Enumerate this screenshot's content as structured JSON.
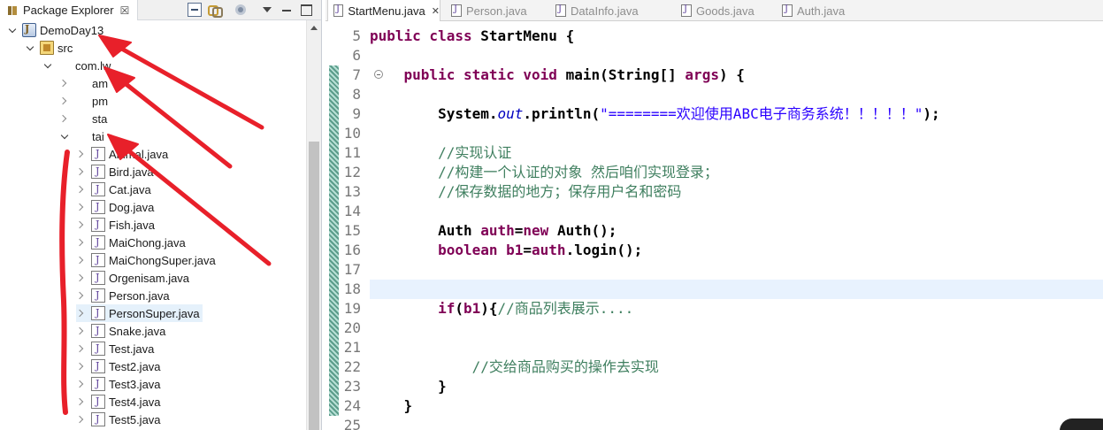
{
  "explorer": {
    "tab_label": "Package Explorer",
    "tab_close": "☒",
    "tree": [
      {
        "label": "DemoDay13",
        "type": "project",
        "state": "expanded",
        "indent": 0
      },
      {
        "label": "src",
        "type": "src",
        "state": "expanded",
        "indent": 1
      },
      {
        "label": "com.lw",
        "type": "package",
        "state": "expanded",
        "indent": 2
      },
      {
        "label": "am",
        "type": "package",
        "state": "collapsed",
        "indent": 3
      },
      {
        "label": "pm",
        "type": "package",
        "state": "collapsed",
        "indent": 3
      },
      {
        "label": "sta",
        "type": "package",
        "state": "collapsed",
        "indent": 3
      },
      {
        "label": "tai",
        "type": "package",
        "state": "expanded",
        "indent": 3
      },
      {
        "label": "Animal.java",
        "type": "java",
        "state": "collapsed",
        "indent": 4
      },
      {
        "label": "Bird.java",
        "type": "java",
        "state": "collapsed",
        "indent": 4
      },
      {
        "label": "Cat.java",
        "type": "java",
        "state": "collapsed",
        "indent": 4
      },
      {
        "label": "Dog.java",
        "type": "java",
        "state": "collapsed",
        "indent": 4
      },
      {
        "label": "Fish.java",
        "type": "java",
        "state": "collapsed",
        "indent": 4
      },
      {
        "label": "MaiChong.java",
        "type": "java",
        "state": "collapsed",
        "indent": 4
      },
      {
        "label": "MaiChongSuper.java",
        "type": "java",
        "state": "collapsed",
        "indent": 4
      },
      {
        "label": "Orgenisam.java",
        "type": "java",
        "state": "collapsed",
        "indent": 4
      },
      {
        "label": "Person.java",
        "type": "java",
        "state": "collapsed",
        "indent": 4
      },
      {
        "label": "PersonSuper.java",
        "type": "java",
        "state": "collapsed",
        "indent": 4,
        "selected": true
      },
      {
        "label": "Snake.java",
        "type": "java",
        "state": "collapsed",
        "indent": 4
      },
      {
        "label": "Test.java",
        "type": "java",
        "state": "collapsed",
        "indent": 4
      },
      {
        "label": "Test2.java",
        "type": "java",
        "state": "collapsed",
        "indent": 4
      },
      {
        "label": "Test3.java",
        "type": "java",
        "state": "collapsed",
        "indent": 4
      },
      {
        "label": "Test4.java",
        "type": "java",
        "state": "collapsed",
        "indent": 4
      },
      {
        "label": "Test5.java",
        "type": "java",
        "state": "collapsed",
        "indent": 4
      }
    ]
  },
  "editor": {
    "tabs": [
      {
        "label": "StartMenu.java",
        "active": true,
        "close": "✕"
      },
      {
        "label": "Person.java",
        "active": false
      },
      {
        "label": "DataInfo.java",
        "active": false
      },
      {
        "label": "Goods.java",
        "active": false
      },
      {
        "label": "Auth.java",
        "active": false
      }
    ],
    "current_line": "18",
    "lines": [
      {
        "num": "5",
        "tokens": [
          {
            "t": "public class ",
            "c": "kw"
          },
          {
            "t": "StartMenu {",
            "c": "plain"
          }
        ]
      },
      {
        "num": "6",
        "tokens": []
      },
      {
        "num": "7",
        "tokens": [
          {
            "t": "    public static void ",
            "c": "kw"
          },
          {
            "t": "main(String[] ",
            "c": "plain"
          },
          {
            "t": "args",
            "c": "kw"
          },
          {
            "t": ") {",
            "c": "plain"
          }
        ]
      },
      {
        "num": "8",
        "tokens": []
      },
      {
        "num": "9",
        "tokens": [
          {
            "t": "        System.",
            "c": "plain"
          },
          {
            "t": "out",
            "c": "fld"
          },
          {
            "t": ".println(",
            "c": "plain"
          },
          {
            "t": "\"========欢迎使用ABC电子商务系统！！！！！\"",
            "c": "str"
          },
          {
            "t": ");",
            "c": "plain"
          }
        ]
      },
      {
        "num": "10",
        "tokens": []
      },
      {
        "num": "11",
        "tokens": [
          {
            "t": "        //实现认证",
            "c": "cm"
          }
        ]
      },
      {
        "num": "12",
        "tokens": [
          {
            "t": "        //构建一个认证的对象 然后咱们实现登录；",
            "c": "cm"
          }
        ]
      },
      {
        "num": "13",
        "tokens": [
          {
            "t": "        //保存数据的地方；保存用户名和密码",
            "c": "cm"
          }
        ]
      },
      {
        "num": "14",
        "tokens": []
      },
      {
        "num": "15",
        "tokens": [
          {
            "t": "        Auth ",
            "c": "plain"
          },
          {
            "t": "auth",
            "c": "kw"
          },
          {
            "t": "=",
            "c": "plain"
          },
          {
            "t": "new ",
            "c": "kw"
          },
          {
            "t": "Auth();",
            "c": "plain"
          }
        ]
      },
      {
        "num": "16",
        "tokens": [
          {
            "t": "        boolean ",
            "c": "kw"
          },
          {
            "t": "b1",
            "c": "kw"
          },
          {
            "t": "=",
            "c": "plain"
          },
          {
            "t": "auth",
            "c": "kw"
          },
          {
            "t": ".login();",
            "c": "plain"
          }
        ]
      },
      {
        "num": "17",
        "tokens": []
      },
      {
        "num": "18",
        "tokens": []
      },
      {
        "num": "19",
        "tokens": [
          {
            "t": "        if",
            "c": "kw"
          },
          {
            "t": "(",
            "c": "plain"
          },
          {
            "t": "b1",
            "c": "kw"
          },
          {
            "t": "){",
            "c": "plain"
          },
          {
            "t": "//商品列表展示....",
            "c": "cm"
          }
        ]
      },
      {
        "num": "20",
        "tokens": []
      },
      {
        "num": "21",
        "tokens": []
      },
      {
        "num": "22",
        "tokens": [
          {
            "t": "            //交给商品购买的操作去实现",
            "c": "cm"
          }
        ]
      },
      {
        "num": "23",
        "tokens": [
          {
            "t": "        }",
            "c": "plain"
          }
        ]
      },
      {
        "num": "24",
        "tokens": [
          {
            "t": "    }",
            "c": "plain"
          }
        ]
      },
      {
        "num": "25",
        "tokens": []
      }
    ]
  },
  "annotation_color": "#e8202a"
}
